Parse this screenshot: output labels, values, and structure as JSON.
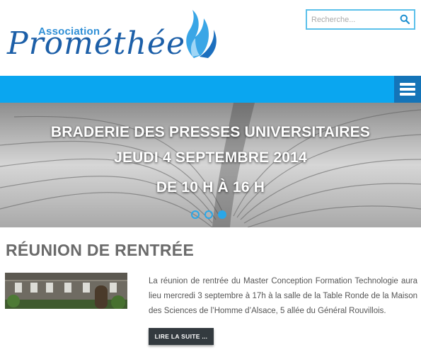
{
  "logo": {
    "small_text": "Association",
    "name": "Prométhée",
    "icon": "flame-icon"
  },
  "search": {
    "placeholder": "Recherche...",
    "icon": "search-icon"
  },
  "nav": {
    "menu_icon": "hamburger-icon",
    "bar_color": "#0aa6f0",
    "button_color": "#1474b8"
  },
  "slider": {
    "lines": [
      "BRADERIE DES PRESSES UNIVERSITAIRES",
      "JEUDI 4 SEPTEMBRE 2014",
      "DE 10 H À 16 H"
    ],
    "dot_count": 3,
    "active_dot": 3
  },
  "article": {
    "title": "RÉUNION DE RENTRÉE",
    "excerpt": "La réunion de rentrée du Master Conception Formation Technologie aura lieu mercredi 3 septembre à 17h à la salle de la Table Ronde de la Maison des Sciences de l’Homme d’Alsace, 5 allée du Général Rouvillois.",
    "read_more": "LIRE LA SUITE ..."
  },
  "colors": {
    "accent": "#2aa7e8",
    "title_gray": "#6a6a6a",
    "button_dark": "#333a3f"
  }
}
